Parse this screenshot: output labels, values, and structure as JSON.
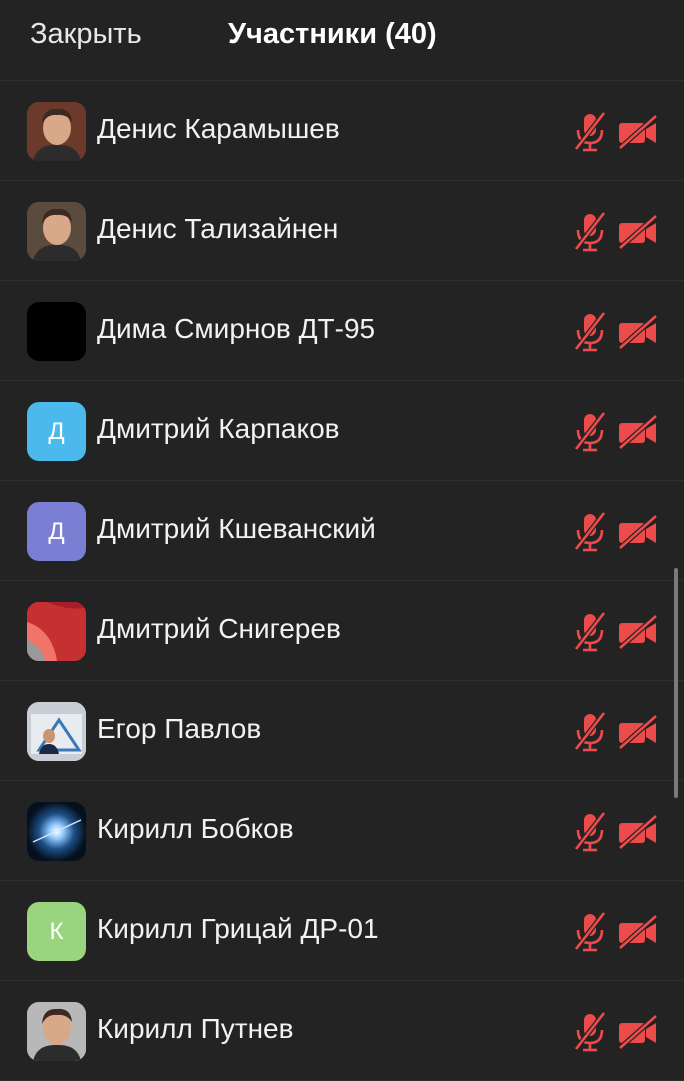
{
  "header": {
    "close_label": "Закрыть",
    "title": "Участники (40)"
  },
  "colors": {
    "muted_icon": "#ec4b4b",
    "background": "#232323"
  },
  "participants": [
    {
      "name": "Денис Карамышев",
      "avatar": {
        "type": "photo",
        "icon": "person-photo-icon",
        "bg": "#6b3a2b"
      },
      "muted": true,
      "video_off": true
    },
    {
      "name": "Денис Тализайнен",
      "avatar": {
        "type": "photo",
        "icon": "person-photo-icon",
        "bg": "#5b4a3e"
      },
      "muted": true,
      "video_off": true
    },
    {
      "name": "Дима Смирнов ДТ-95",
      "avatar": {
        "type": "solid",
        "icon": "black-avatar-icon",
        "bg": "#000000"
      },
      "muted": true,
      "video_off": true
    },
    {
      "name": "Дмитрий Карпаков",
      "avatar": {
        "type": "initial",
        "initial": "Д",
        "bg": "#4bb9ec"
      },
      "muted": true,
      "video_off": true
    },
    {
      "name": "Дмитрий Кшеванский",
      "avatar": {
        "type": "initial",
        "initial": "Д",
        "bg": "#7b7fd4"
      },
      "muted": true,
      "video_off": true
    },
    {
      "name": "Дмитрий Снигерев",
      "avatar": {
        "type": "wallpaper",
        "icon": "abstract-wallpaper-icon",
        "bg": "#e0413a"
      },
      "muted": true,
      "video_off": true
    },
    {
      "name": "Егор Павлов",
      "avatar": {
        "type": "photo",
        "icon": "document-photo-icon",
        "bg": "#c9ced6"
      },
      "muted": true,
      "video_off": true
    },
    {
      "name": "Кирилл Бобков",
      "avatar": {
        "type": "photo",
        "icon": "space-photo-icon",
        "bg": "#0d2a4a"
      },
      "muted": true,
      "video_off": true
    },
    {
      "name": "Кирилл Грицай ДР-01",
      "avatar": {
        "type": "initial",
        "initial": "К",
        "bg": "#9bd47f"
      },
      "muted": true,
      "video_off": true
    },
    {
      "name": "Кирилл Путнев",
      "avatar": {
        "type": "photo",
        "icon": "person-photo-icon",
        "bg": "#b8b8b8"
      },
      "muted": true,
      "video_off": true
    }
  ]
}
